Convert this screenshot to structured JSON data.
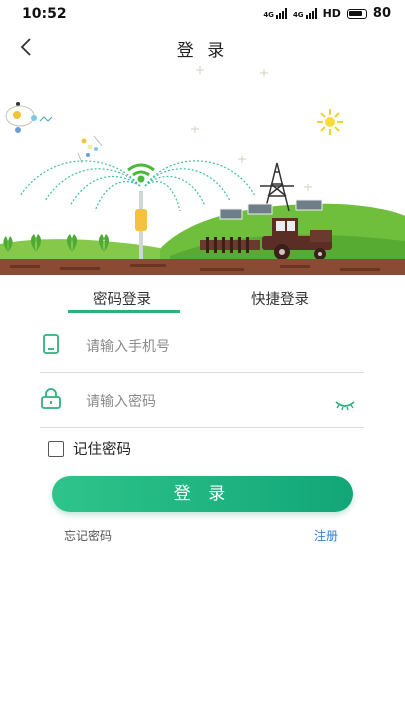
{
  "status_bar": {
    "time": "10:52",
    "network_1": "4G",
    "network_2": "4G",
    "hd": "HD",
    "battery": "80"
  },
  "nav": {
    "title": "登 录",
    "back_icon": "chevron-left-icon"
  },
  "tabs": [
    {
      "label": "密码登录",
      "active": true
    },
    {
      "label": "快捷登录",
      "active": false
    }
  ],
  "form": {
    "phone_placeholder": "请输入手机号",
    "password_placeholder": "请输入密码",
    "remember_label": "记住密码",
    "remember_checked": false,
    "submit_label": "登 录",
    "forgot_label": "忘记密码",
    "register_label": "注册"
  },
  "colors": {
    "accent": "#2bb27b",
    "button_start": "#2ec48a",
    "button_end": "#12a678",
    "link": "#2f7bd6"
  }
}
